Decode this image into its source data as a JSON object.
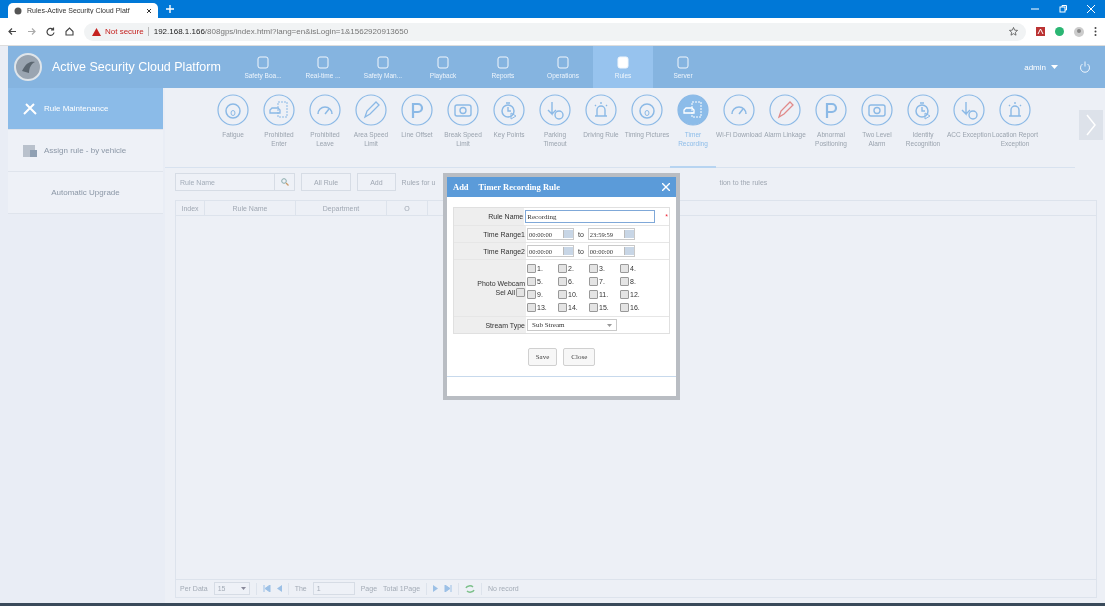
{
  "browser": {
    "tab_title": "Rules-Active Security Cloud Platf",
    "security": "Not secure",
    "url_host": "192.168.1.166",
    "url_path": "/808gps/index.html?lang=en&isLogin=1&1562920913650"
  },
  "header": {
    "title": "Active Security Cloud Platform",
    "user": "admin",
    "nav": [
      {
        "label": "Safety Boa...",
        "selected": false
      },
      {
        "label": "Real-time ...",
        "selected": false
      },
      {
        "label": "Safety Man...",
        "selected": false
      },
      {
        "label": "Playback",
        "selected": false
      },
      {
        "label": "Reports",
        "selected": false
      },
      {
        "label": "Operations",
        "selected": false
      },
      {
        "label": "Rules",
        "selected": true
      },
      {
        "label": "Server",
        "selected": false
      }
    ]
  },
  "sidebar": {
    "items": [
      {
        "label": "Rule Maintenance",
        "selected": true
      },
      {
        "label": "Assign rule - by vehicle",
        "selected": false
      },
      {
        "label": "Automatic Upgrade",
        "selected": false
      }
    ]
  },
  "rule_types": [
    {
      "label": "Fatigue",
      "selected": false
    },
    {
      "label": "Prohibited Enter",
      "selected": false
    },
    {
      "label": "Prohibited Leave",
      "selected": false
    },
    {
      "label": "Area Speed Limit",
      "selected": false
    },
    {
      "label": "Line Offset",
      "selected": false
    },
    {
      "label": "Break Speed Limit",
      "selected": false
    },
    {
      "label": "Key Points",
      "selected": false
    },
    {
      "label": "Parking Timeout",
      "selected": false
    },
    {
      "label": "Driving Rule",
      "selected": false
    },
    {
      "label": "Timing Pictures",
      "selected": false
    },
    {
      "label": "Timer Recording",
      "selected": true
    },
    {
      "label": "Wi-Fi Download",
      "selected": false
    },
    {
      "label": "Alarm Linkage",
      "selected": false
    },
    {
      "label": "Abnormal Positioning",
      "selected": false
    },
    {
      "label": "Two Level Alarm",
      "selected": false
    },
    {
      "label": "Identity Recognition",
      "selected": false
    },
    {
      "label": "ACC Exception",
      "selected": false
    },
    {
      "label": "Location Report Exception",
      "selected": false
    }
  ],
  "toolbar": {
    "search_placeholder": "Rule Name",
    "buttons": [
      "All Rule",
      "Add"
    ],
    "note_left": "Rules for u",
    "note_right": "tion to the rules"
  },
  "table": {
    "columns": [
      "Index",
      "Rule Name",
      "Department",
      "O"
    ]
  },
  "pager": {
    "per_data_label": "Per Data",
    "per_data": "15",
    "the": "The",
    "page": "1",
    "page_label": "Page",
    "total": "Total 1Page",
    "status": "No record"
  },
  "dialog": {
    "title_prefix": "Add",
    "title": "Timer Recording Rule",
    "rule_name_label": "Rule Name",
    "rule_name": "Recording",
    "required_mark": "*",
    "ranges": [
      {
        "label": "Time Range1",
        "from": "00:00:00",
        "to_label": "to",
        "to": "23:59:59"
      },
      {
        "label": "Time Range2",
        "from": "00:00:00",
        "to_label": "to",
        "to": "00:00:00"
      }
    ],
    "webcam_label": "Photo Webcam",
    "sel_all_label": "Sel All",
    "sel_all": false,
    "webcams": [
      {
        "label": "1.",
        "checked": false
      },
      {
        "label": "2.",
        "checked": false
      },
      {
        "label": "3.",
        "checked": false
      },
      {
        "label": "4.",
        "checked": false
      },
      {
        "label": "5.",
        "checked": false
      },
      {
        "label": "6.",
        "checked": false
      },
      {
        "label": "7.",
        "checked": false
      },
      {
        "label": "8.",
        "checked": false
      },
      {
        "label": "9.",
        "checked": false
      },
      {
        "label": "10.",
        "checked": false
      },
      {
        "label": "11.",
        "checked": false
      },
      {
        "label": "12.",
        "checked": false
      },
      {
        "label": "13.",
        "checked": false
      },
      {
        "label": "14.",
        "checked": false
      },
      {
        "label": "15.",
        "checked": false
      },
      {
        "label": "16.",
        "checked": false
      }
    ],
    "stream_label": "Stream Type",
    "stream": "Sub Stream",
    "buttons": [
      "Save",
      "Close"
    ]
  }
}
